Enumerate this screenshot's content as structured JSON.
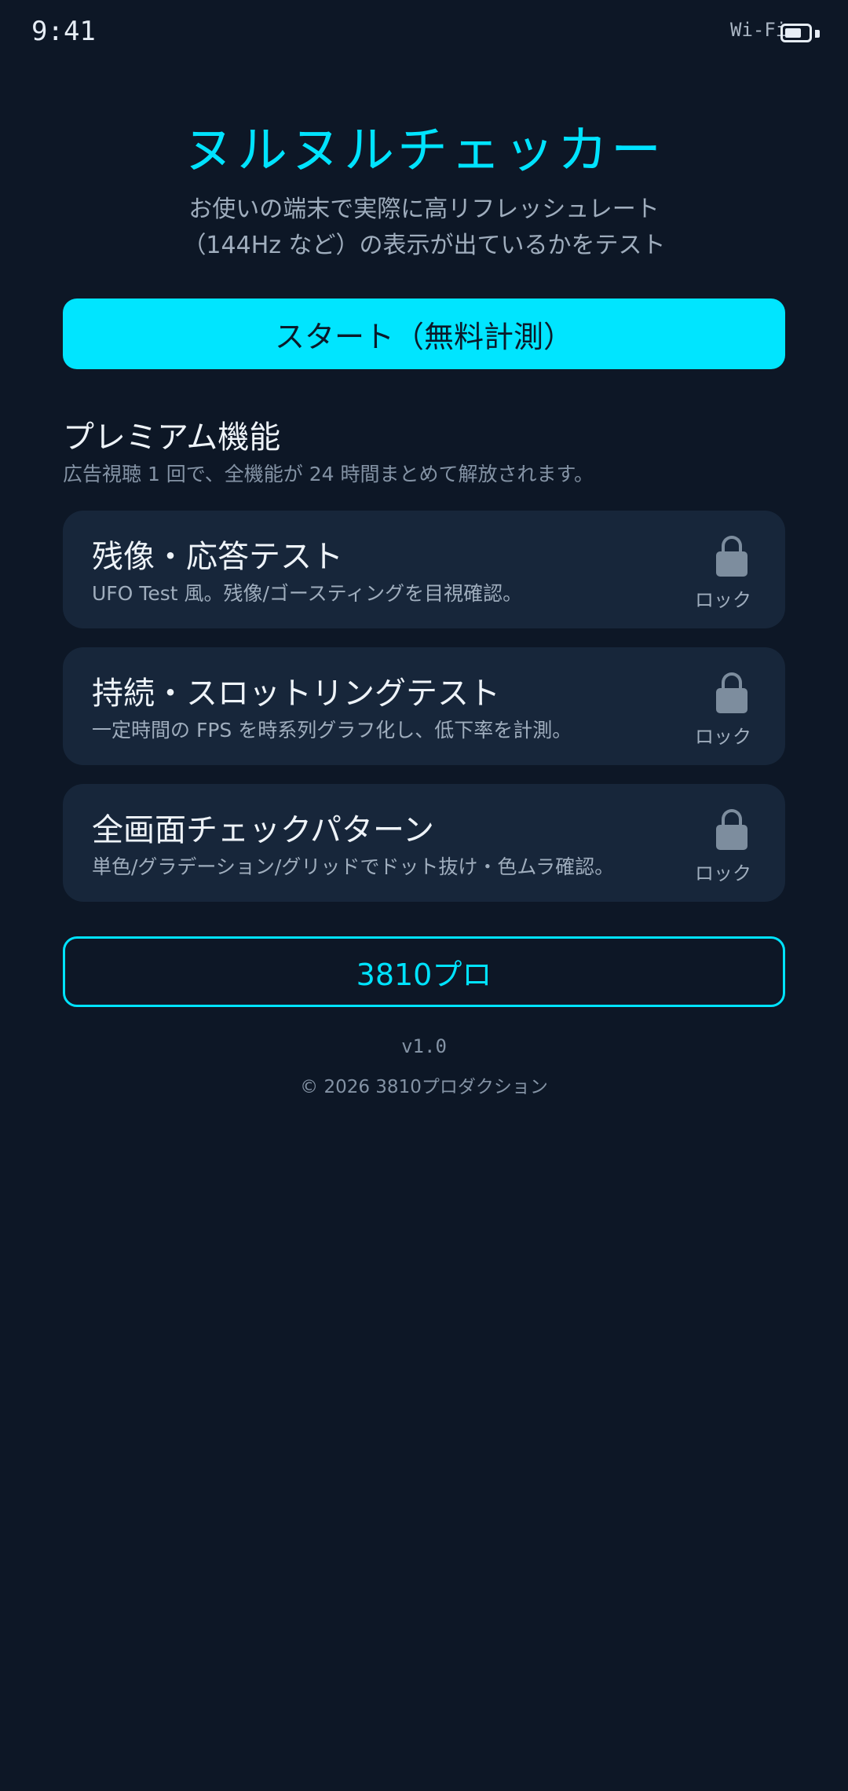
{
  "status_bar": {
    "time": "9:41",
    "network": "Wi-Fi",
    "battery_level": 0.7
  },
  "header": {
    "title": "ヌルヌルチェッカー",
    "subtitle_line1": "お使いの端末で実際に高リフレッシュレート",
    "subtitle_line2": "（144Hz など）の表示が出ているかをテスト"
  },
  "start_button": {
    "label": "スタート（無料計測）"
  },
  "premium": {
    "title": "プレミアム機能",
    "note": "広告視聴 1 回で、全機能が 24 時間まとめて解放されます。",
    "features": [
      {
        "title": "残像・応答テスト",
        "description": "UFO Test 風。残像/ゴースティングを目視確認。",
        "status": "ロック",
        "icon": "lock-icon"
      },
      {
        "title": "持続・スロットリングテスト",
        "description": "一定時間の FPS を時系列グラフ化し、低下率を計測。",
        "status": "ロック",
        "icon": "lock-icon"
      },
      {
        "title": "全画面チェックパターン",
        "description": "単色/グラデーション/グリッドでドット抜け・色ムラ確認。",
        "status": "ロック",
        "icon": "lock-icon"
      }
    ]
  },
  "pro_button": {
    "label": "3810プロ"
  },
  "footer": {
    "version": "v1.0",
    "copyright": "© 2026 3810プロダクション"
  },
  "colors": {
    "background": "#0d1726",
    "accent": "#00e5ff",
    "card": "#17263a",
    "lock": "#7d8d9e"
  }
}
